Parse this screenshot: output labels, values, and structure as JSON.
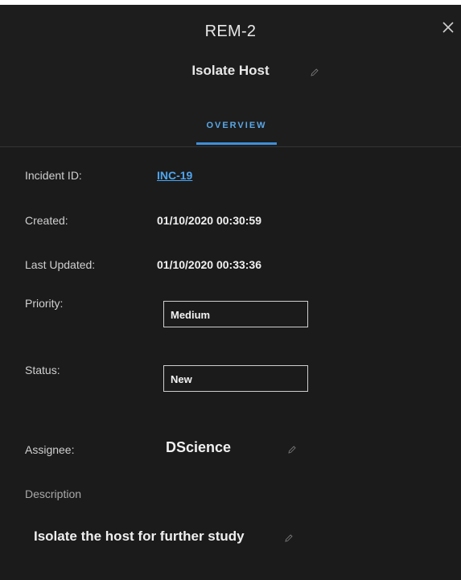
{
  "header": {
    "title": "REM-2",
    "subtitle": "Isolate Host",
    "tabs": [
      {
        "label": "OVERVIEW",
        "active": true
      }
    ]
  },
  "fields": {
    "incident_id": {
      "label": "Incident ID:",
      "value": "INC-19"
    },
    "created": {
      "label": "Created:",
      "value": "01/10/2020 00:30:59"
    },
    "last_updated": {
      "label": "Last Updated:",
      "value": "01/10/2020 00:33:36"
    },
    "priority": {
      "label": "Priority:",
      "value": "Medium"
    },
    "status": {
      "label": "Status:",
      "value": "New"
    },
    "assignee": {
      "label": "Assignee:",
      "value": "DScience"
    },
    "description": {
      "label": "Description",
      "value": "Isolate the host for further study"
    }
  },
  "icons": {
    "close": "close-icon",
    "edit": "pencil-icon"
  },
  "colors": {
    "background": "#1b1b1b",
    "accent": "#3f8fd9",
    "link": "#4ea5f0"
  }
}
